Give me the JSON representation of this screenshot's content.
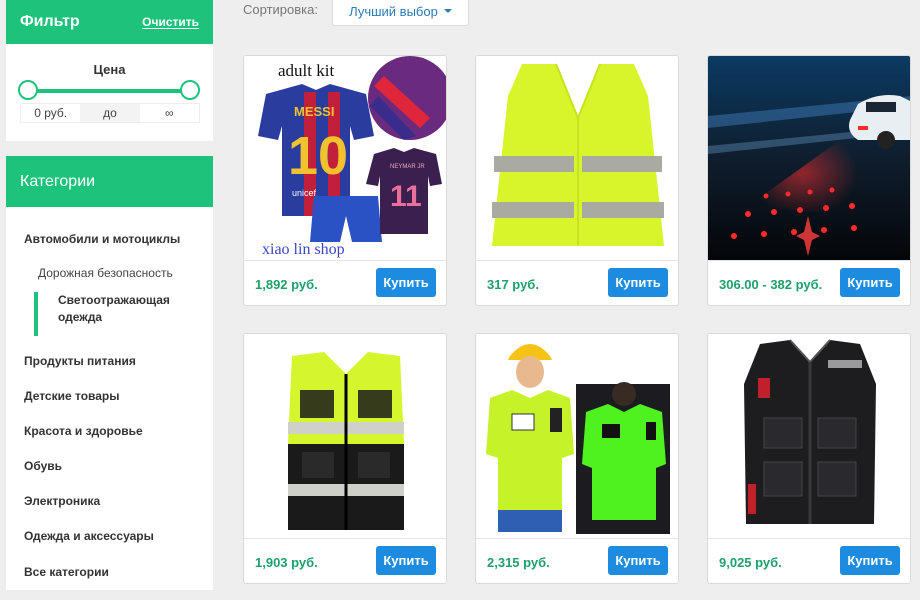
{
  "filter": {
    "title": "Фильтр",
    "clear_label": "Очистить"
  },
  "price": {
    "title": "Цена",
    "min": "0 руб.",
    "to": "до",
    "max": "∞"
  },
  "categories": {
    "title": "Категории",
    "items": [
      "Автомобили и мотоциклы",
      "Продукты питания",
      "Детские товары",
      "Красота и здоровье",
      "Обувь",
      "Электроника",
      "Одежда и аксессуары",
      "Все категории"
    ],
    "sub": "Дорожная безопасность",
    "active": "Светоотражающая одежда"
  },
  "sort": {
    "label": "Сортировка:",
    "value": "Лучший выбор"
  },
  "products": [
    {
      "price": "1,892 руб.",
      "buy": "Купить",
      "img_text_top": "adult kit",
      "img_text_bottom": "xiao lin shop",
      "jersey_name": "MESSI",
      "jersey_number": "10",
      "jersey_number_2": "11",
      "jersey_brand": "unicef",
      "jersey_name_2": "NEYMAR JR"
    },
    {
      "price": "317 руб.",
      "buy": "Купить"
    },
    {
      "price": "306.00 - 382 руб.",
      "buy": "Купить"
    },
    {
      "price": "1,903 руб.",
      "buy": "Купить"
    },
    {
      "price": "2,315 руб.",
      "buy": "Купить"
    },
    {
      "price": "9,025 руб.",
      "buy": "Купить"
    }
  ],
  "colors": {
    "accent": "#1ec37b",
    "button": "#1d8be0",
    "price": "#1ea06b"
  }
}
